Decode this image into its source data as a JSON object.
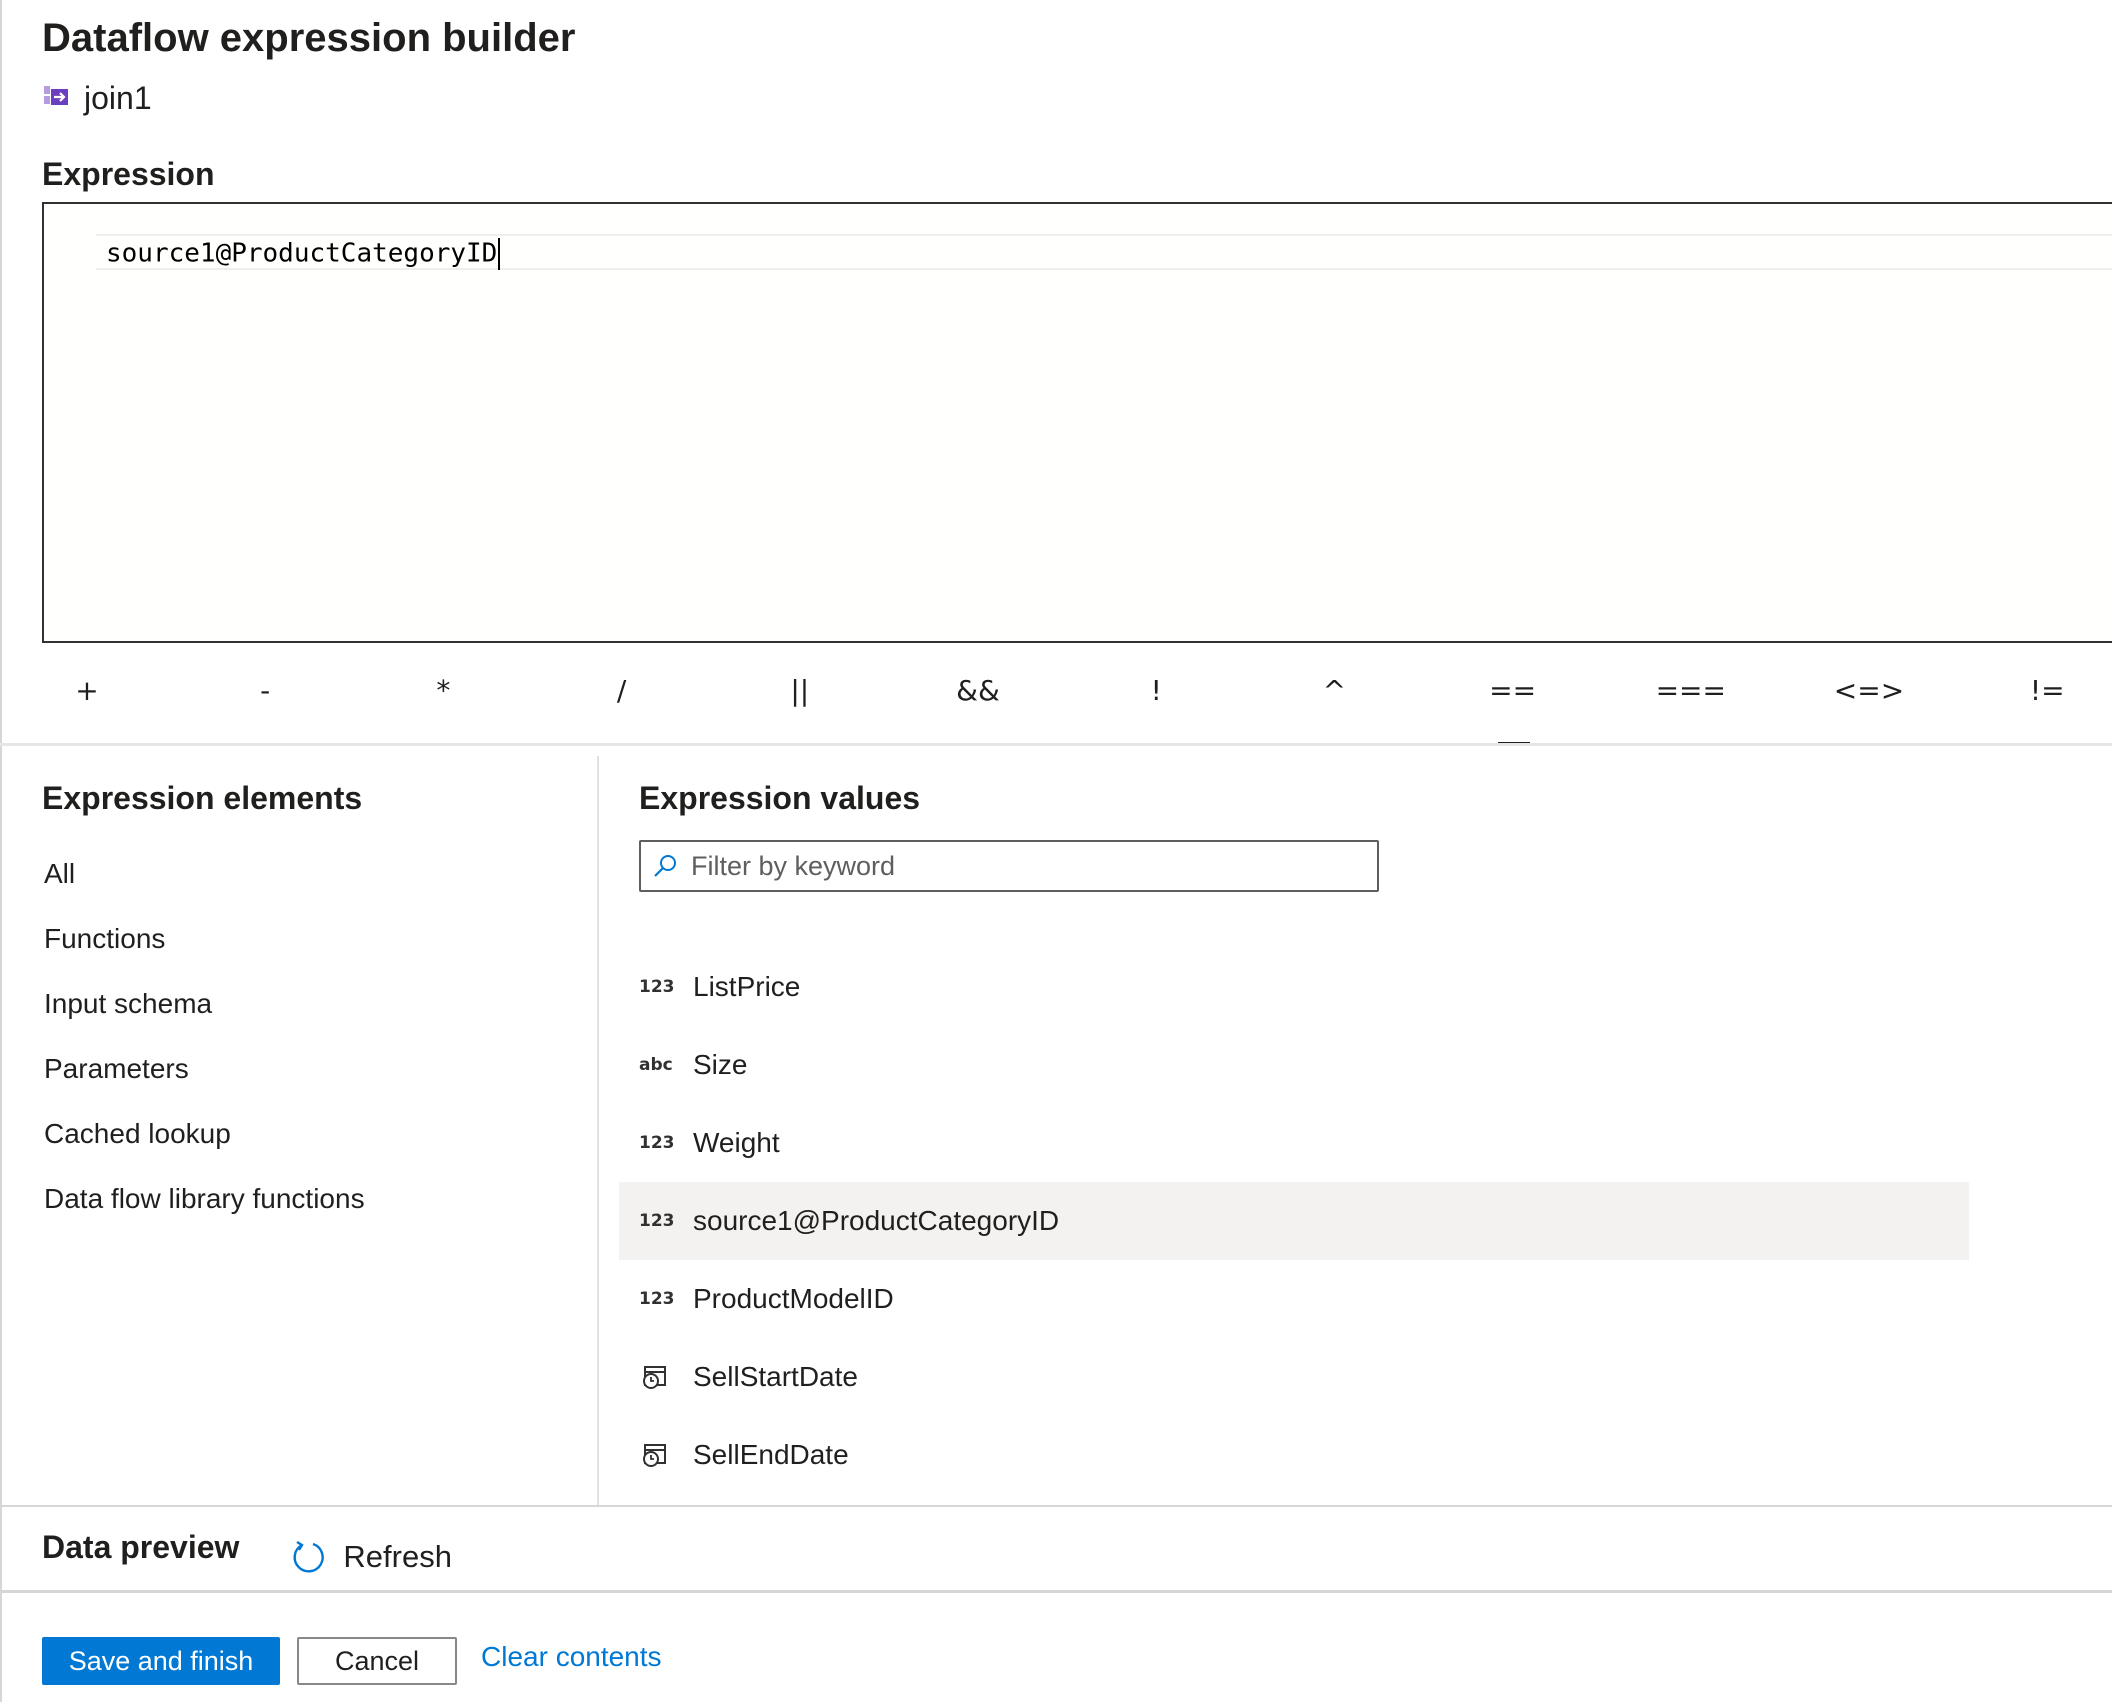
{
  "header": {
    "title": "Dataflow expression builder",
    "node_name": "join1"
  },
  "expression": {
    "label": "Expression",
    "value": "source1@ProductCategoryID"
  },
  "operators": [
    "+",
    "-",
    "*",
    "/",
    "||",
    "&&",
    "!",
    "^",
    "==",
    "===",
    "<=>",
    "!="
  ],
  "active_operator": "==",
  "elements": {
    "title": "Expression elements",
    "items": [
      "All",
      "Functions",
      "Input schema",
      "Parameters",
      "Cached lookup",
      "Data flow library functions"
    ]
  },
  "values": {
    "title": "Expression values",
    "filter_placeholder": "Filter by keyword",
    "items": [
      {
        "type": "123",
        "name": "ListPrice",
        "icon": "number-type-icon"
      },
      {
        "type": "abc",
        "name": "Size",
        "icon": "string-type-icon"
      },
      {
        "type": "123",
        "name": "Weight",
        "icon": "number-type-icon"
      },
      {
        "type": "123",
        "name": "source1@ProductCategoryID",
        "icon": "number-type-icon",
        "selected": true
      },
      {
        "type": "123",
        "name": "ProductModelID",
        "icon": "number-type-icon"
      },
      {
        "type": "date",
        "name": "SellStartDate",
        "icon": "datetime-type-icon"
      },
      {
        "type": "date",
        "name": "SellEndDate",
        "icon": "datetime-type-icon"
      }
    ]
  },
  "preview": {
    "label": "Data preview",
    "refresh_label": "Refresh"
  },
  "footer": {
    "save_label": "Save and finish",
    "cancel_label": "Cancel",
    "clear_label": "Clear contents"
  },
  "colors": {
    "accent": "#0078d4",
    "node_icon": "#8661c5",
    "selected_row": "#f3f2f1"
  }
}
